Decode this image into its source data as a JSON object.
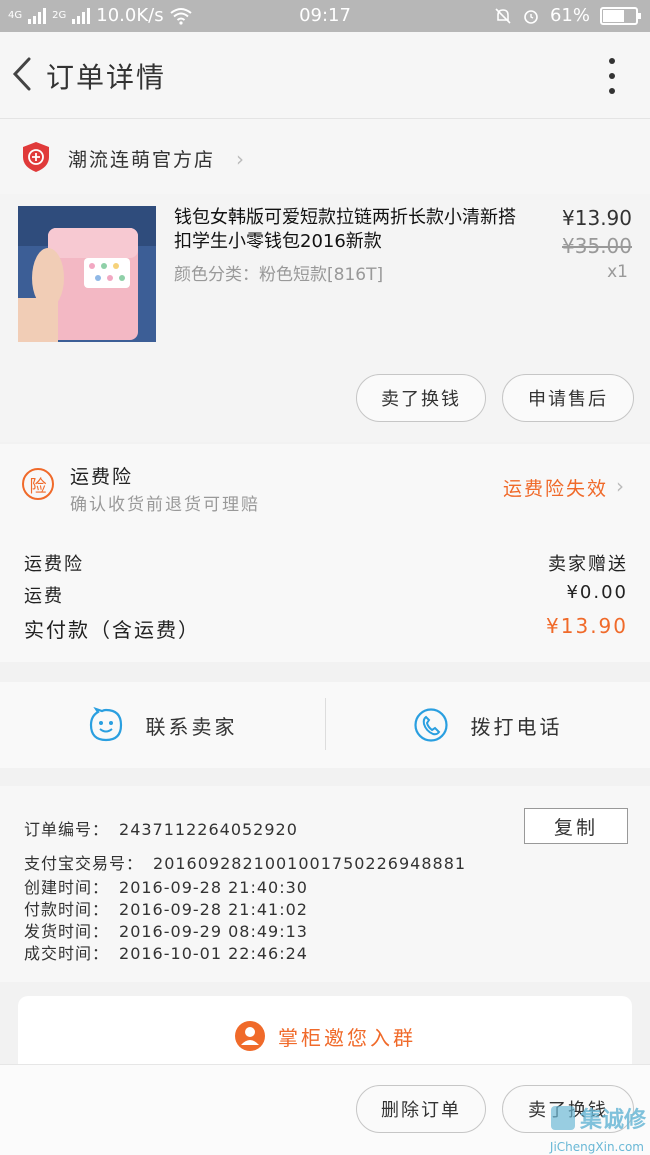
{
  "status_bar": {
    "network1": "4G",
    "network2": "2G",
    "speed": "10.0K/s",
    "time": "09:17",
    "battery": "61%"
  },
  "header": {
    "title": "订单详情"
  },
  "shop": {
    "name": "潮流连萌官方店"
  },
  "item": {
    "title": "钱包女韩版可爱短款拉链两折长款小清新搭扣学生小零钱包2016新款",
    "sku": "颜色分类：粉色短款[816T]",
    "price": "¥13.90",
    "original_price": "¥35.00",
    "quantity": "x1"
  },
  "actions": {
    "resell": "卖了换钱",
    "after_sale": "申请售后"
  },
  "insurance": {
    "title": "运费险",
    "subtitle": "确认收货前退货可理赔",
    "status": "运费险失效"
  },
  "fees": {
    "insurance_label": "运费险",
    "insurance_value": "卖家赠送",
    "shipping_label": "运费",
    "shipping_value": "¥0.00",
    "total_label": "实付款（含运费）",
    "total_value": "¥13.90"
  },
  "contact": {
    "seller": "联系卖家",
    "call": "拨打电话"
  },
  "order_info": {
    "order_no_label": "订单编号：",
    "order_no": "2437112264052920",
    "copy": "复制",
    "alipay_label": "支付宝交易号：",
    "alipay_no": "2016092821001001750226948881",
    "created_label": "创建时间：",
    "created": "2016-09-28 21:40:30",
    "paid_label": "付款时间：",
    "paid": "2016-09-28 21:41:02",
    "shipped_label": "发货时间：",
    "shipped": "2016-09-29 08:49:13",
    "done_label": "成交时间：",
    "done": "2016-10-01 22:46:24"
  },
  "group_invite": {
    "label": "掌柜邀您入群"
  },
  "footer": {
    "delete": "删除订单",
    "resell": "卖了换钱"
  },
  "watermark": {
    "text": "集诚修",
    "sub": "JiChengXin.com"
  },
  "colors": {
    "accent": "#f06a2a",
    "link_blue": "#2a9fe0",
    "shop_badge": "#e03a3a"
  }
}
